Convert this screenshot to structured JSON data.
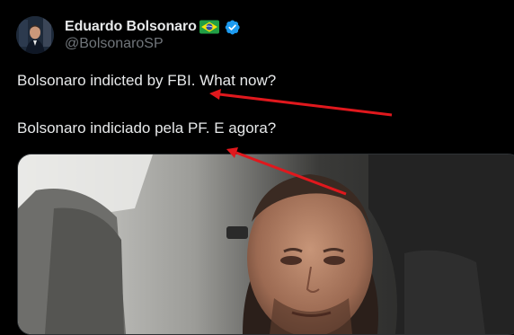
{
  "author": {
    "display_name": "Eduardo Bolsonaro",
    "handle": "@BolsonaroSP",
    "flag_icon": "brazil-flag-icon",
    "verified_icon": "verified-badge-icon",
    "verified_color": "#1d9bf0"
  },
  "tweet": {
    "line1": "Bolsonaro indicted by FBI. What now?",
    "line2": "Bolsonaro indiciado pela PF. E agora?"
  },
  "media": {
    "type": "video-thumbnail"
  },
  "annotations": {
    "arrow_color": "#e0181d"
  },
  "colors": {
    "background": "#000000",
    "text_primary": "#e7e9ea",
    "text_secondary": "#71767b"
  }
}
